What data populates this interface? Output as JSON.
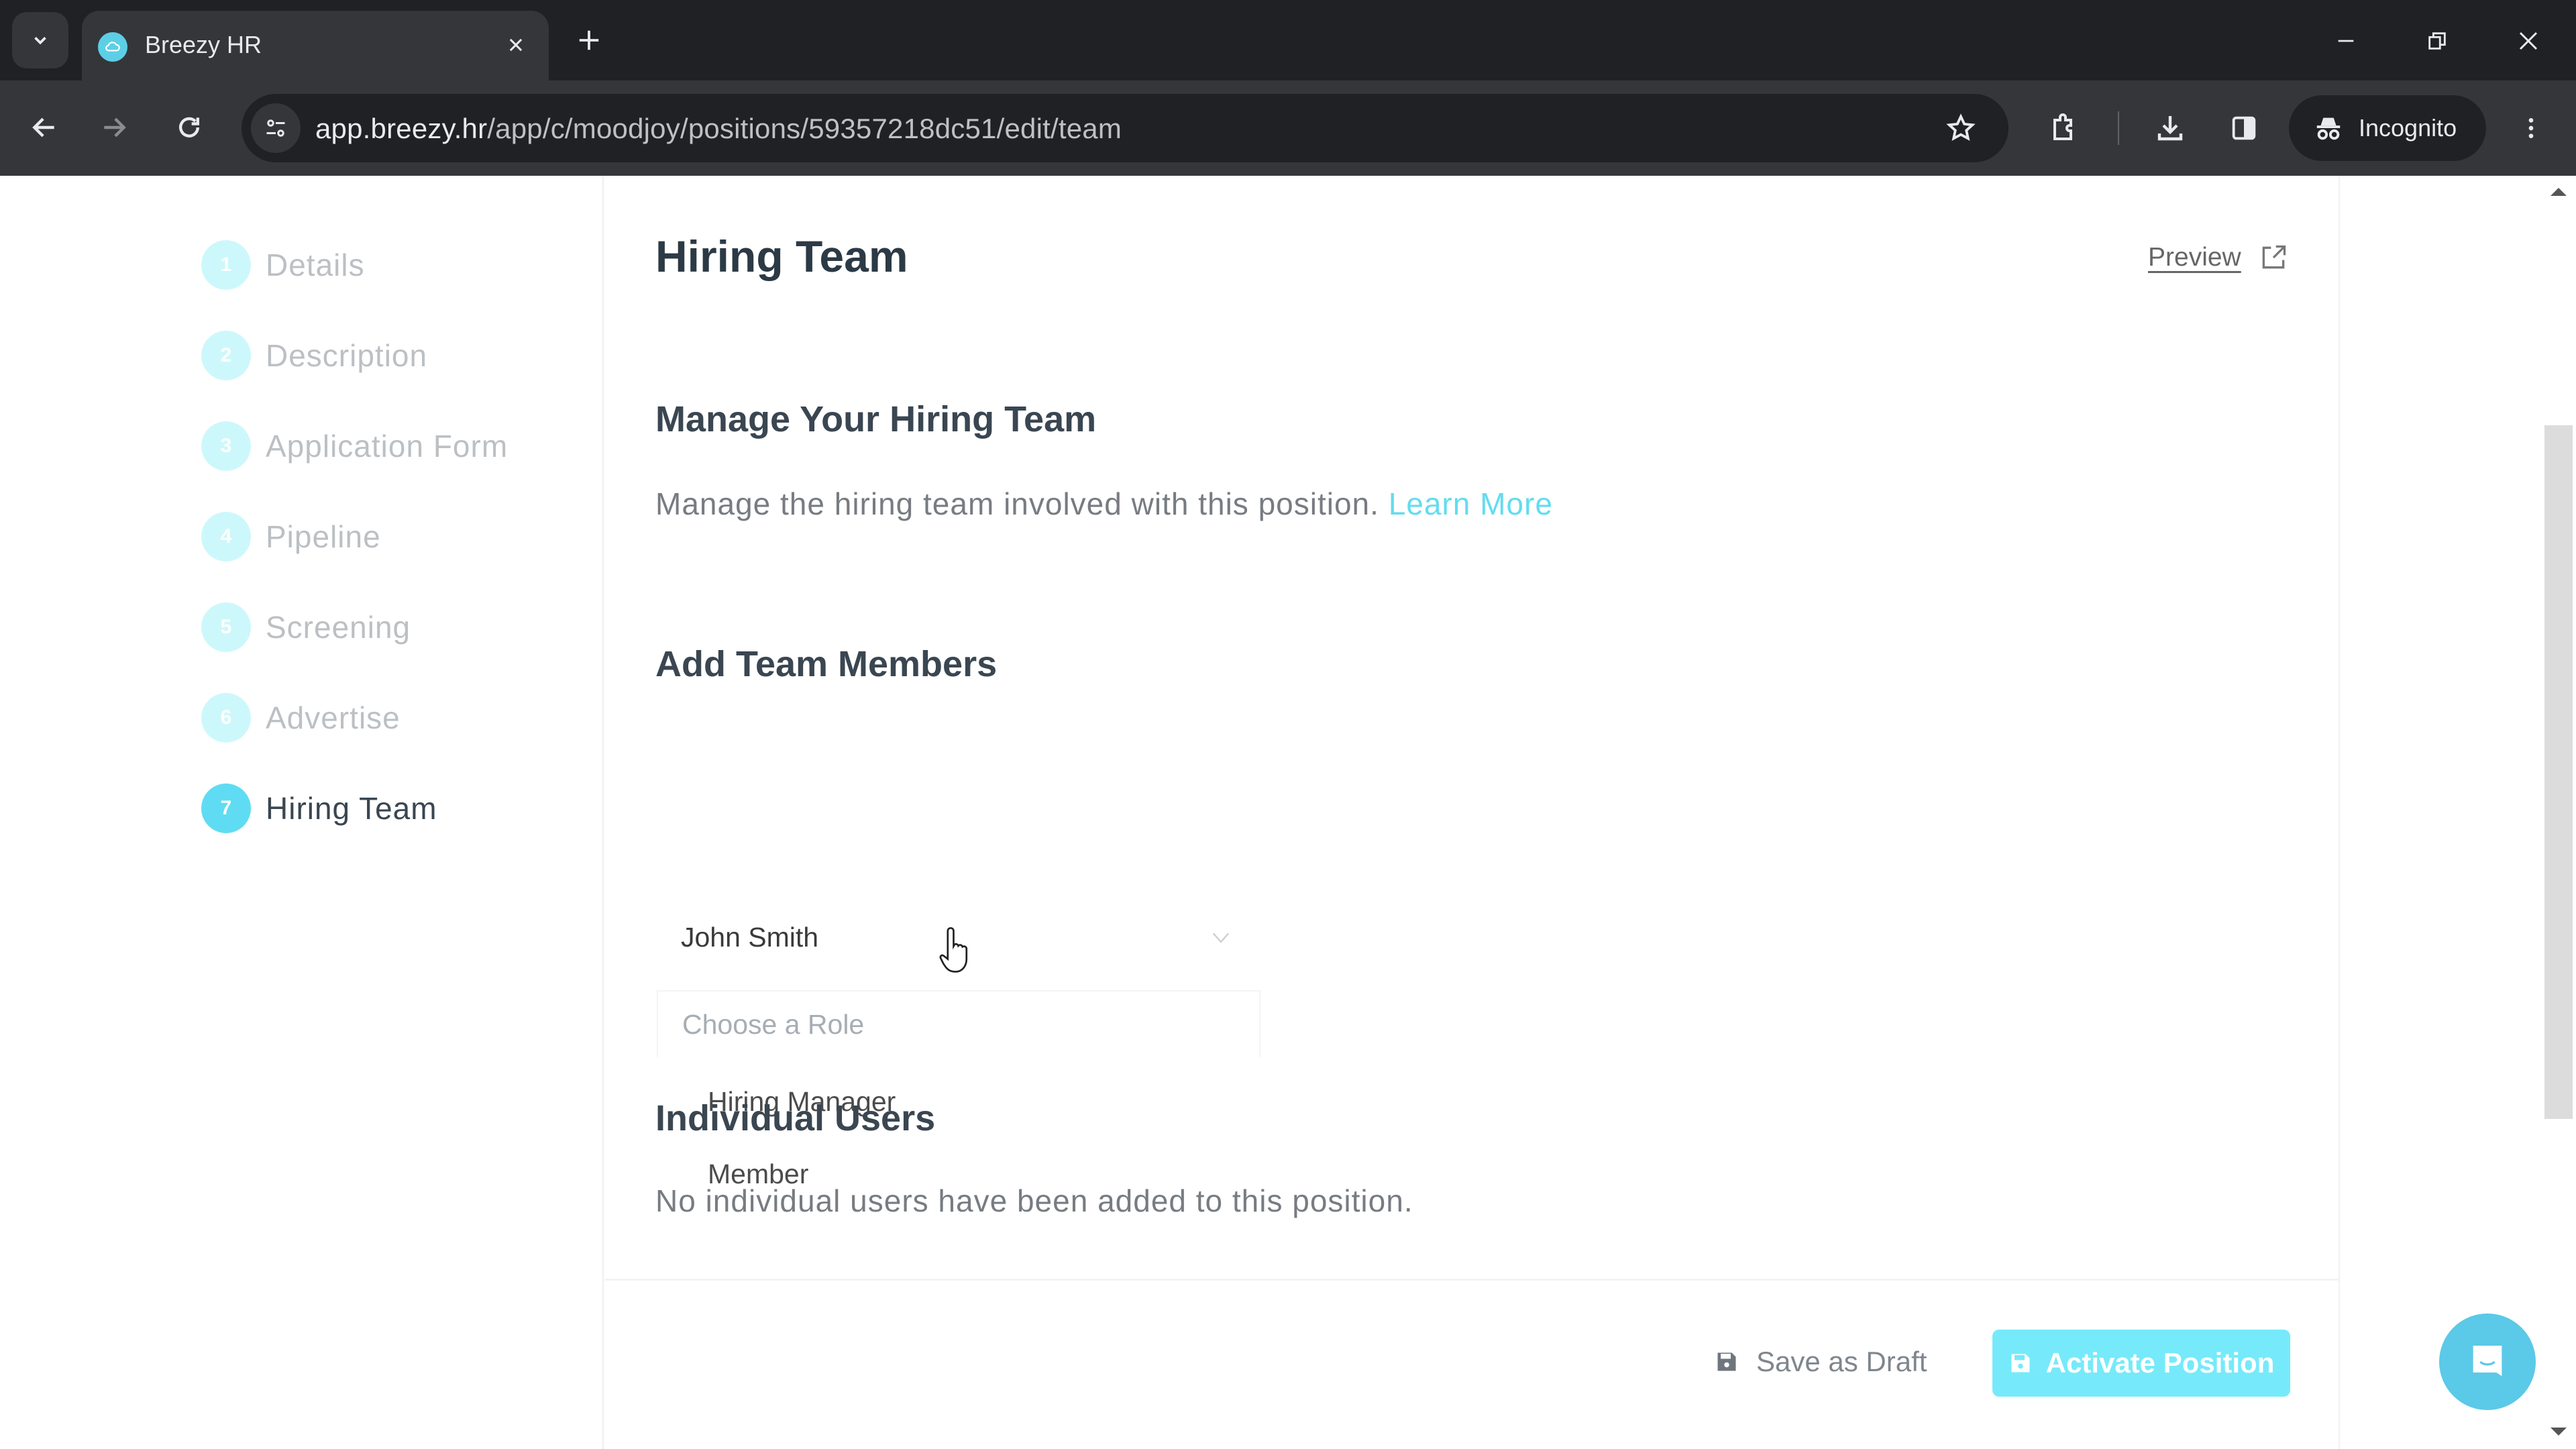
{
  "browser": {
    "tab_title": "Breezy HR",
    "url_host": "app.breezy.hr",
    "url_path": "/app/c/moodjoy/positions/59357218dc51/edit/team",
    "profile_label": "Incognito"
  },
  "sidebar": {
    "steps": [
      {
        "number": "1",
        "label": "Details"
      },
      {
        "number": "2",
        "label": "Description"
      },
      {
        "number": "3",
        "label": "Application Form"
      },
      {
        "number": "4",
        "label": "Pipeline"
      },
      {
        "number": "5",
        "label": "Screening"
      },
      {
        "number": "6",
        "label": "Advertise"
      },
      {
        "number": "7",
        "label": "Hiring Team"
      }
    ],
    "active_step": "7"
  },
  "main": {
    "title": "Hiring Team",
    "preview_label": "Preview",
    "manage_heading": "Manage Your Hiring Team",
    "manage_text": "Manage the hiring team involved with this position.",
    "learn_more": "Learn More",
    "add_heading": "Add Team Members",
    "member_select_value": "John Smith",
    "role_placeholder": "Choose a Role",
    "role_options": [
      "Hiring Manager",
      "Member"
    ],
    "individual_heading": "Individual Users",
    "individual_empty": "No individual users have been added to this position."
  },
  "footer": {
    "save_draft_label": "Save as Draft",
    "activate_label": "Activate Position"
  },
  "colors": {
    "accent": "#5fdcf3",
    "accent_button": "#76eafa",
    "chat_bubble": "#5bc9e8"
  }
}
